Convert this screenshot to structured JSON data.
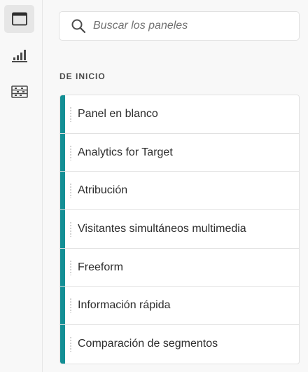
{
  "rail": {
    "buttons": [
      {
        "icon": "panel-window-icon",
        "active": true
      },
      {
        "icon": "bar-chart-icon",
        "active": false
      },
      {
        "icon": "table-rows-icon",
        "active": false
      }
    ]
  },
  "search": {
    "placeholder": "Buscar los paneles",
    "value": ""
  },
  "section": {
    "title": "DE INICIO"
  },
  "panels": [
    {
      "label": "Panel en blanco"
    },
    {
      "label": "Analytics for Target"
    },
    {
      "label": "Atribución"
    },
    {
      "label": "Visitantes simultáneos multimedia"
    },
    {
      "label": "Freeform"
    },
    {
      "label": "Información rápida"
    },
    {
      "label": "Comparación de segmentos"
    }
  ],
  "colors": {
    "accent": "#138f95",
    "background": "#f8f8f8",
    "card": "#ffffff",
    "border": "#e1e1e1",
    "text": "#2c2c2c"
  }
}
